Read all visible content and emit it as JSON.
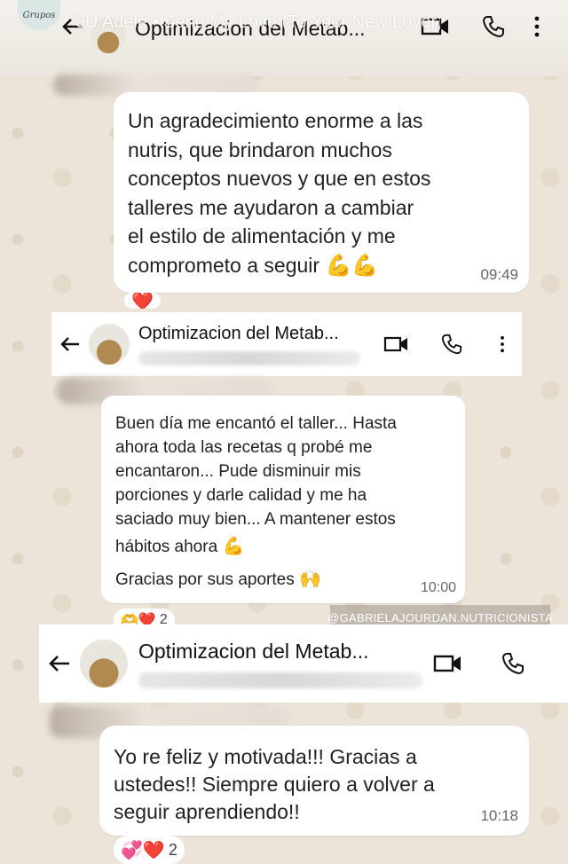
{
  "story": {
    "badge": "Grupos",
    "music_text": "JU Adele • Send My Love (To Your New Lover)",
    "top_text": "GRUPOS online · 22 de mayo"
  },
  "chats": [
    {
      "title": "Optimizacion del Metab...",
      "message_lines": [
        "Un agradecimiento enorme a las",
        "nutris, que brindaron muchos",
        "conceptos nuevos y que en estos",
        "talleres  me ayudaron a cambiar",
        "el estilo de alimentación y me",
        "comprometo a seguir"
      ],
      "message_emoji": "💪💪",
      "time": "09:49",
      "reaction_emoji": "❤️"
    },
    {
      "title": "Optimizacion del Metab...",
      "subtitle_dots": "...",
      "message_lines": [
        "Buen día me encantó el taller... Hasta",
        "ahora toda las recetas q probé me",
        "encantaron... Pude disminuir mis",
        "porciones y darle calidad y me ha",
        "saciado muy bien... A mantener estos",
        "hábitos ahora"
      ],
      "message_emoji": "💪",
      "extra_line": "Gracias por sus aportes",
      "extra_emoji": "🙌",
      "time": "10:00",
      "reactions": "🫶❤️",
      "reaction_count": "2"
    },
    {
      "title": "Optimizacion del Metab...",
      "message_lines": [
        "Yo re feliz y motivada!!! Gracias a",
        "ustedes!! Siempre quiero a volver a",
        "seguir aprendiendo!!"
      ],
      "time": "10:18",
      "reactions": "💞❤️",
      "reaction_count": "2"
    }
  ],
  "watermark": "@GABRIELAJOURDAN.NUTRICIONISTA",
  "colors": {
    "bubble": "#ffffff",
    "wallpaper": "#ece4d8",
    "header": "#ffffff",
    "timestamp": "#666666"
  },
  "icons": [
    "back-arrow-icon",
    "video-call-icon",
    "phone-icon",
    "more-vert-icon"
  ]
}
